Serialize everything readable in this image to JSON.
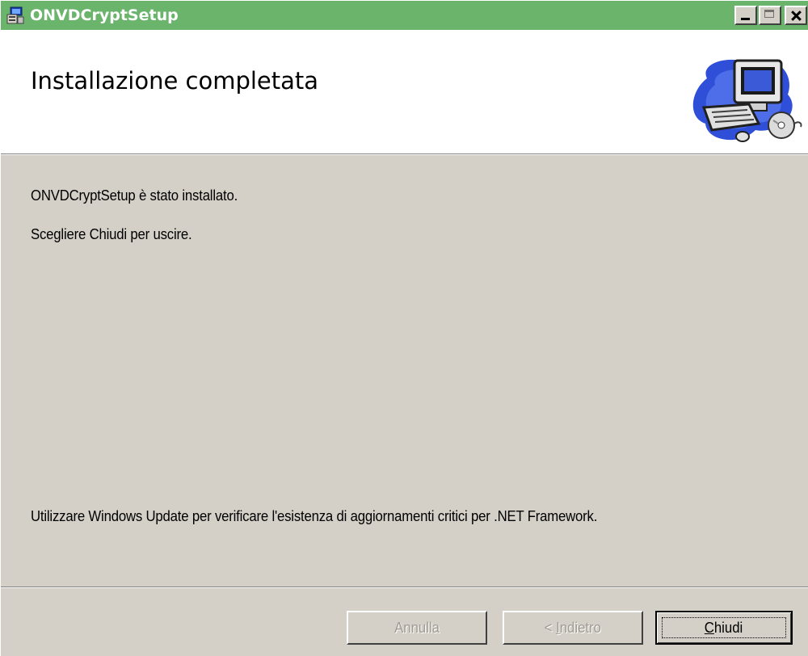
{
  "window": {
    "title": "ONVDCryptSetup",
    "controls": {
      "minimize_icon": "minimize-icon",
      "maximize_icon": "maximize-icon",
      "close_icon": "close-icon"
    },
    "titlebar_color": "#6ab46c"
  },
  "banner": {
    "heading": "Installazione completata",
    "art_icon": "computer-install-icon"
  },
  "body": {
    "line1": "ONVDCryptSetup è stato installato.",
    "line2": "Scegliere Chiudi per uscire.",
    "line3": "Utilizzare Windows Update per verificare l'esistenza di aggiornamenti critici per .NET Framework."
  },
  "buttons": {
    "cancel": {
      "label": "Annulla",
      "enabled": false
    },
    "back": {
      "label_prefix": "< ",
      "label_access": "I",
      "label_rest": "ndietro",
      "enabled": false
    },
    "close": {
      "label_access": "C",
      "label_rest": "hiudi",
      "enabled": true,
      "default": true
    }
  }
}
